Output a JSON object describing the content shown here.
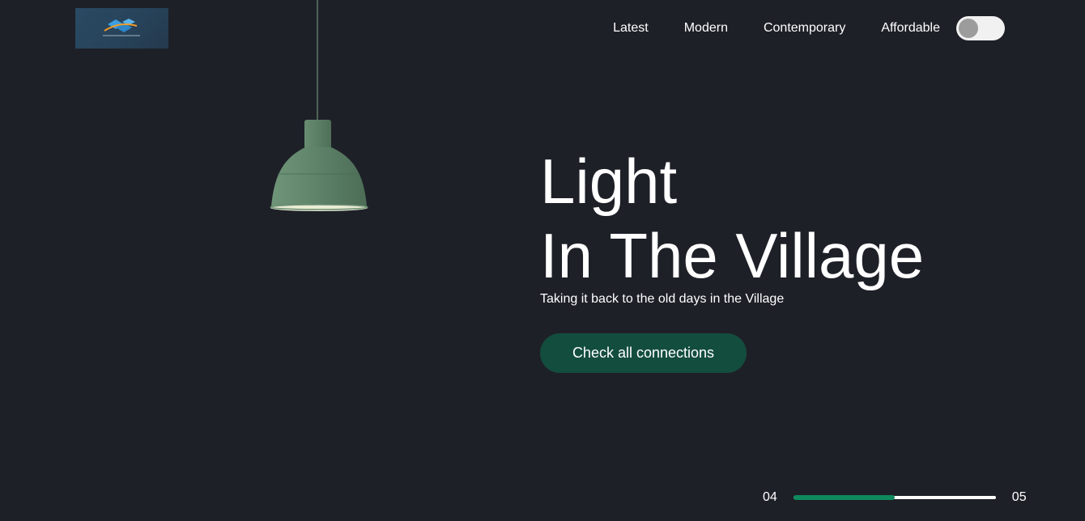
{
  "logo": {
    "icon": "brand-logo"
  },
  "nav": {
    "items": [
      {
        "label": "Latest"
      },
      {
        "label": "Modern"
      },
      {
        "label": "Contemporary"
      },
      {
        "label": "Affordable"
      }
    ],
    "theme_toggle": {
      "state": "off"
    }
  },
  "hero": {
    "title_line1": "Light",
    "title_line2": "In The Village",
    "subtitle": "Taking it back to the old days in the Village",
    "cta_label": "Check all connections",
    "image": "pendant-lamp"
  },
  "slider": {
    "current": "04",
    "total": "05",
    "progress": 0.5
  },
  "colors": {
    "background": "#1e2028",
    "cta": "#134d3e",
    "progress_fill": "#0e8a5c",
    "lamp": "#5e8268"
  }
}
